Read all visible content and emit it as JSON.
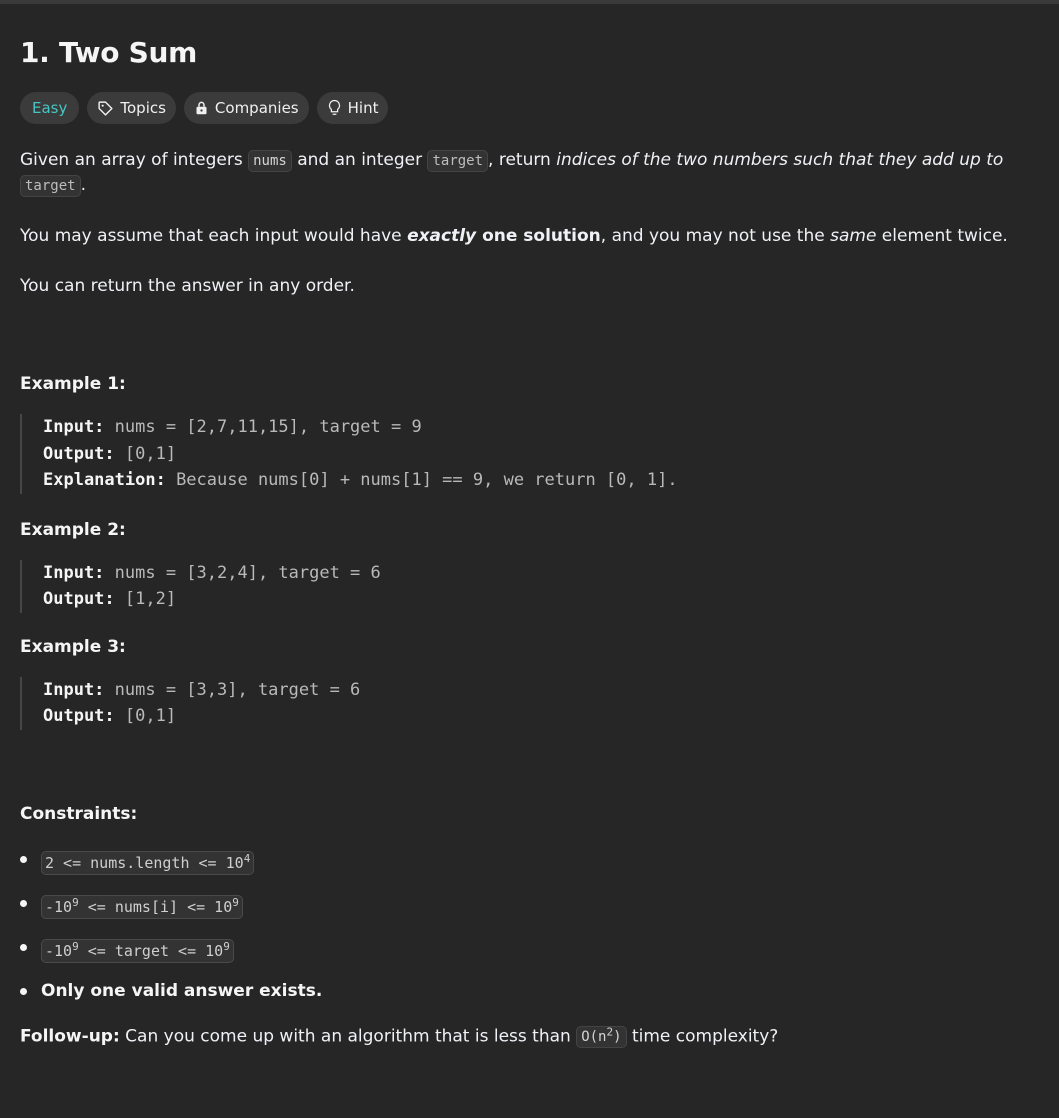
{
  "problem": {
    "title": "1. Two Sum",
    "tags": {
      "difficulty": "Easy",
      "topics": "Topics",
      "companies": "Companies",
      "hint": "Hint"
    },
    "description": {
      "p1": {
        "a": "Given an array of integers ",
        "code1": "nums",
        "b": " and an integer ",
        "code2": "target",
        "c": ", return ",
        "em": "indices of the two numbers such that they add up to",
        "d": " ",
        "code3": "target",
        "e": "."
      },
      "p2": {
        "a": "You may assume that each input would have ",
        "em_bold": "exactly",
        "bold": " one solution",
        "b": ", and you may not use the ",
        "em": "same",
        "c": " element twice."
      },
      "p3": "You can return the answer in any order."
    },
    "examples": [
      {
        "title": "Example 1:",
        "input_label": "Input:",
        "input": " nums = [2,7,11,15], target = 9",
        "output_label": "Output:",
        "output": " [0,1]",
        "explanation_label": "Explanation:",
        "explanation": " Because nums[0] + nums[1] == 9, we return [0, 1]."
      },
      {
        "title": "Example 2:",
        "input_label": "Input:",
        "input": " nums = [3,2,4], target = 6",
        "output_label": "Output:",
        "output": " [1,2]"
      },
      {
        "title": "Example 3:",
        "input_label": "Input:",
        "input": " nums = [3,3], target = 6",
        "output_label": "Output:",
        "output": " [0,1]"
      }
    ],
    "constraints": {
      "title": "Constraints:",
      "c1": {
        "pre": "2 <= nums.length <= 10",
        "sup": "4"
      },
      "c2": {
        "a": "-10",
        "sup1": "9",
        "b": " <= nums[i] <= 10",
        "sup2": "9"
      },
      "c3": {
        "a": "-10",
        "sup1": "9",
        "b": " <= target <= 10",
        "sup2": "9"
      },
      "c4": "Only one valid answer exists."
    },
    "followup": {
      "label": "Follow-up:",
      "a": " Can you come up with an algorithm that is less than ",
      "code_pre": "O(n",
      "code_sup": "2",
      "code_post": ")",
      "b": " time complexity?"
    }
  }
}
